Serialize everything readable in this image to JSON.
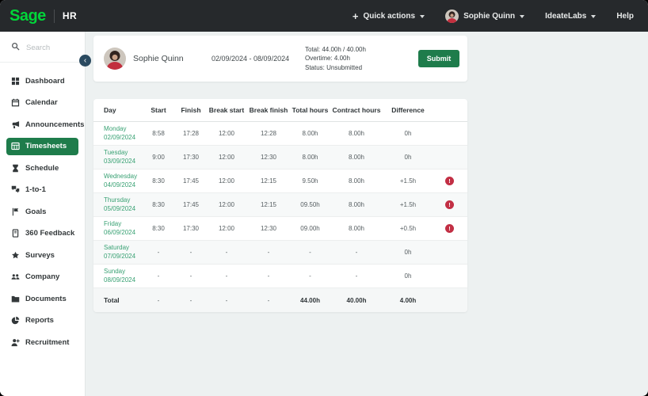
{
  "topbar": {
    "brand": "Sage",
    "product": "HR",
    "quick_actions_label": "Quick actions",
    "user_name": "Sophie Quinn",
    "company_name": "IdeateLabs",
    "help_label": "Help"
  },
  "sidebar": {
    "search_placeholder": "Search",
    "items": [
      {
        "label": "Dashboard",
        "icon": "dashboard-icon",
        "active": false
      },
      {
        "label": "Calendar",
        "icon": "calendar-icon",
        "active": false
      },
      {
        "label": "Announcements",
        "icon": "megaphone-icon",
        "active": false
      },
      {
        "label": "Timesheets",
        "icon": "timesheet-icon",
        "active": true
      },
      {
        "label": "Schedule",
        "icon": "hourglass-icon",
        "active": false
      },
      {
        "label": "1-to-1",
        "icon": "chat-icon",
        "active": false
      },
      {
        "label": "Goals",
        "icon": "flag-icon",
        "active": false
      },
      {
        "label": "360 Feedback",
        "icon": "feedback-icon",
        "active": false
      },
      {
        "label": "Surveys",
        "icon": "star-icon",
        "active": false
      },
      {
        "label": "Company",
        "icon": "people-icon",
        "active": false
      },
      {
        "label": "Documents",
        "icon": "folder-icon",
        "active": false
      },
      {
        "label": "Reports",
        "icon": "pie-chart-icon",
        "active": false
      },
      {
        "label": "Recruitment",
        "icon": "person-add-icon",
        "active": false
      }
    ]
  },
  "header_card": {
    "employee_name": "Sophie Quinn",
    "period": "02/09/2024 - 08/09/2024",
    "summary": {
      "total": "Total: 44.00h / 40.00h",
      "overtime": "Overtime: 4.00h",
      "status": "Status: Unsubmitted"
    },
    "submit_label": "Submit"
  },
  "table": {
    "columns": [
      "Day",
      "Start",
      "Finish",
      "Break start",
      "Break finish",
      "Total hours",
      "Contract hours",
      "Difference"
    ],
    "rows": [
      {
        "day": "Monday",
        "date": "02/09/2024",
        "start": "8:58",
        "finish": "17:28",
        "break_start": "12:00",
        "break_finish": "12:28",
        "total": "8.00h",
        "contract": "8.00h",
        "difference": "0h",
        "warning": false
      },
      {
        "day": "Tuesday",
        "date": "03/09/2024",
        "start": "9:00",
        "finish": "17:30",
        "break_start": "12:00",
        "break_finish": "12:30",
        "total": "8.00h",
        "contract": "8.00h",
        "difference": "0h",
        "warning": false
      },
      {
        "day": "Wednesday",
        "date": "04/09/2024",
        "start": "8:30",
        "finish": "17:45",
        "break_start": "12:00",
        "break_finish": "12:15",
        "total": "9.50h",
        "contract": "8.00h",
        "difference": "+1.5h",
        "warning": true
      },
      {
        "day": "Thursday",
        "date": "05/09/2024",
        "start": "8:30",
        "finish": "17:45",
        "break_start": "12:00",
        "break_finish": "12:15",
        "total": "09.50h",
        "contract": "8.00h",
        "difference": "+1.5h",
        "warning": true
      },
      {
        "day": "Friday",
        "date": "06/09/2024",
        "start": "8:30",
        "finish": "17:30",
        "break_start": "12:00",
        "break_finish": "12:30",
        "total": "09.00h",
        "contract": "8.00h",
        "difference": "+0.5h",
        "warning": true
      },
      {
        "day": "Saturday",
        "date": "07/09/2024",
        "start": "-",
        "finish": "-",
        "break_start": "-",
        "break_finish": "-",
        "total": "-",
        "contract": "-",
        "difference": "0h",
        "warning": false
      },
      {
        "day": "Sunday",
        "date": "08/09/2024",
        "start": "-",
        "finish": "-",
        "break_start": "-",
        "break_finish": "-",
        "total": "-",
        "contract": "-",
        "difference": "0h",
        "warning": false
      }
    ],
    "total_row": {
      "label": "Total",
      "start": "-",
      "finish": "-",
      "break_start": "-",
      "break_finish": "-",
      "total": "44.00h",
      "contract": "40.00h",
      "difference": "4.00h"
    }
  },
  "colors": {
    "brand_green": "#00d639",
    "accent_green": "#1e7c4b",
    "day_text_green": "#38a173",
    "warning_red": "#c22f44",
    "topbar_bg": "#26292c",
    "page_bg": "#edf1f1"
  }
}
